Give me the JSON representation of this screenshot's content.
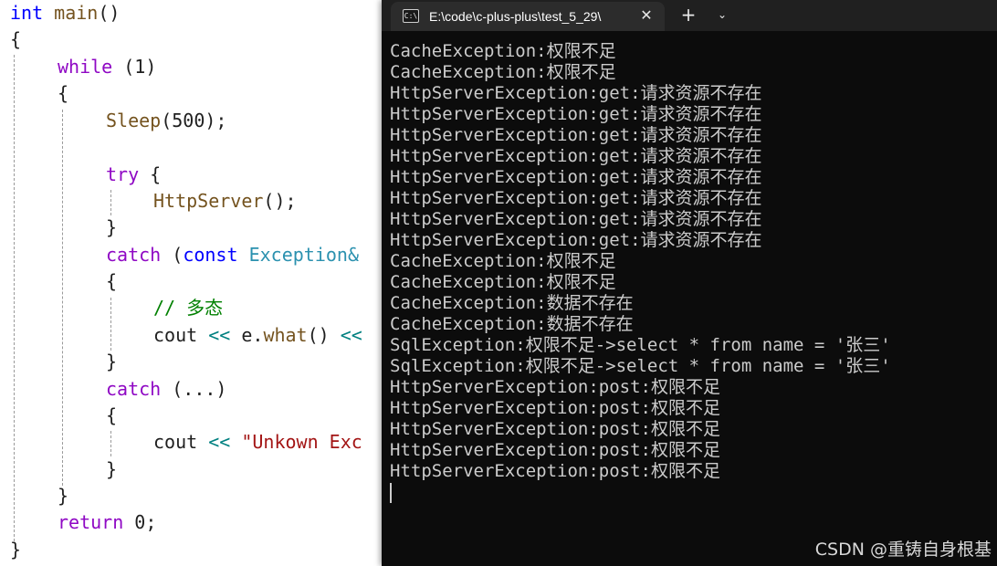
{
  "editor": {
    "code": {
      "sig_type": "int",
      "sig_fn": "main",
      "sig_paren": "()",
      "brace_open": "{",
      "brace_close": "}",
      "while_kw": "while",
      "while_cond": " (1)",
      "sleep_fn": "Sleep",
      "sleep_open": "(",
      "sleep_arg": "500",
      "sleep_close": ");",
      "try_kw": "try",
      "try_brace": " {",
      "http_fn": "HttpServer",
      "http_call": "();",
      "catch_kw": "catch",
      "catch_open": " (",
      "const_kw": "const",
      "exc_type": " Exception&",
      "comment": "// 多态",
      "cout": "cout",
      "shift_op": " <<",
      "e_var": " e",
      "dot": ".",
      "what_fn": "what",
      "what_call": "()",
      "shift_op2": " <<",
      "catch_all": " (...)",
      "cout2": "cout",
      "shift_op3": " <<",
      "unknown_str": " \"Unkown Exc",
      "return_kw": "return",
      "return_val": " 0;"
    }
  },
  "terminal": {
    "tab_title": "E:\\code\\c-plus-plus\\test_5_29\\",
    "tab_icon_glyph": "C:\\",
    "close_glyph": "✕",
    "new_tab_glyph": "+",
    "dropdown_glyph": "⌄",
    "output_lines": [
      "CacheException:权限不足",
      "CacheException:权限不足",
      "HttpServerException:get:请求资源不存在",
      "HttpServerException:get:请求资源不存在",
      "HttpServerException:get:请求资源不存在",
      "HttpServerException:get:请求资源不存在",
      "HttpServerException:get:请求资源不存在",
      "HttpServerException:get:请求资源不存在",
      "HttpServerException:get:请求资源不存在",
      "HttpServerException:get:请求资源不存在",
      "CacheException:权限不足",
      "CacheException:权限不足",
      "CacheException:数据不存在",
      "CacheException:数据不存在",
      "SqlException:权限不足->select * from name = '张三'",
      "SqlException:权限不足->select * from name = '张三'",
      "HttpServerException:post:权限不足",
      "HttpServerException:post:权限不足",
      "HttpServerException:post:权限不足",
      "HttpServerException:post:权限不足",
      "HttpServerException:post:权限不足"
    ]
  },
  "watermark": "CSDN @重铸自身根基",
  "colors": {
    "keyword_blue": "#0000ff",
    "keyword_purple": "#8f08c4",
    "function": "#74531f",
    "type": "#2b91af",
    "string": "#a31515",
    "comment": "#008000",
    "terminal_bg": "#0c0c0c",
    "terminal_text": "#cccccc"
  },
  "icons": [
    "console-icon",
    "close-icon",
    "plus-icon",
    "chevron-down-icon"
  ]
}
